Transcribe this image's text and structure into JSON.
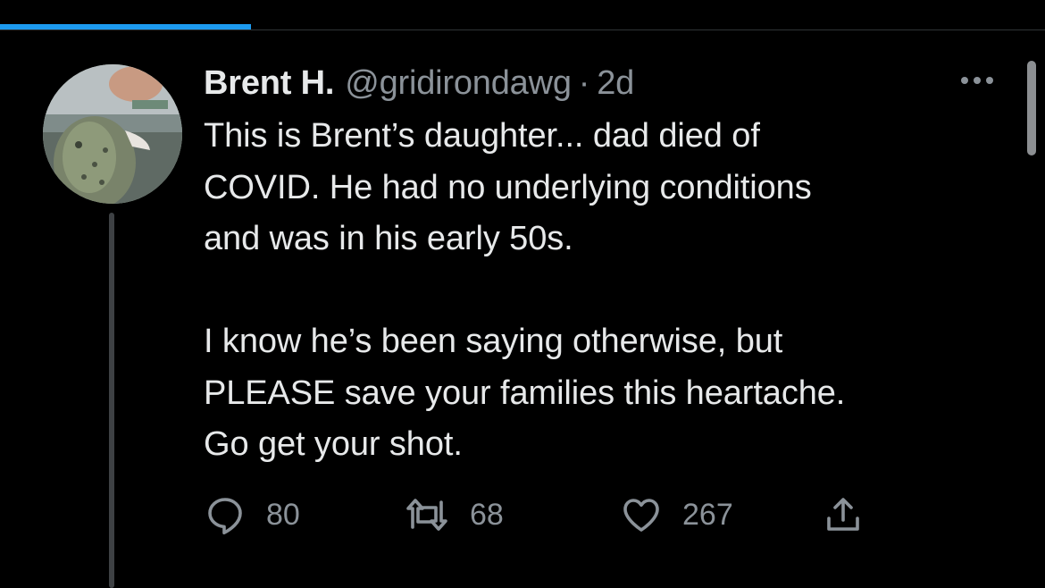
{
  "tweet": {
    "display_name": "Brent H.",
    "handle": "@gridirondawg",
    "separator": "·",
    "time": "2d",
    "paragraphs": [
      "This is Brent’s daughter... dad died of\nCOVID. He had no underlying conditions\nand was in his early 50s.",
      "I know he’s been saying otherwise, but\nPLEASE save your families this heartache.\nGo get your shot."
    ]
  },
  "actions": {
    "reply_count": "80",
    "retweet_count": "68",
    "like_count": "267"
  },
  "icons": {
    "more": "more-horizontal-icon",
    "reply": "reply-icon",
    "retweet": "retweet-icon",
    "like": "heart-icon",
    "share": "share-icon"
  },
  "colors": {
    "background": "#000000",
    "text_primary": "#e7e9ea",
    "text_secondary": "#8b9299",
    "accent": "#1d9bf0",
    "thread_line": "#3e4144"
  }
}
